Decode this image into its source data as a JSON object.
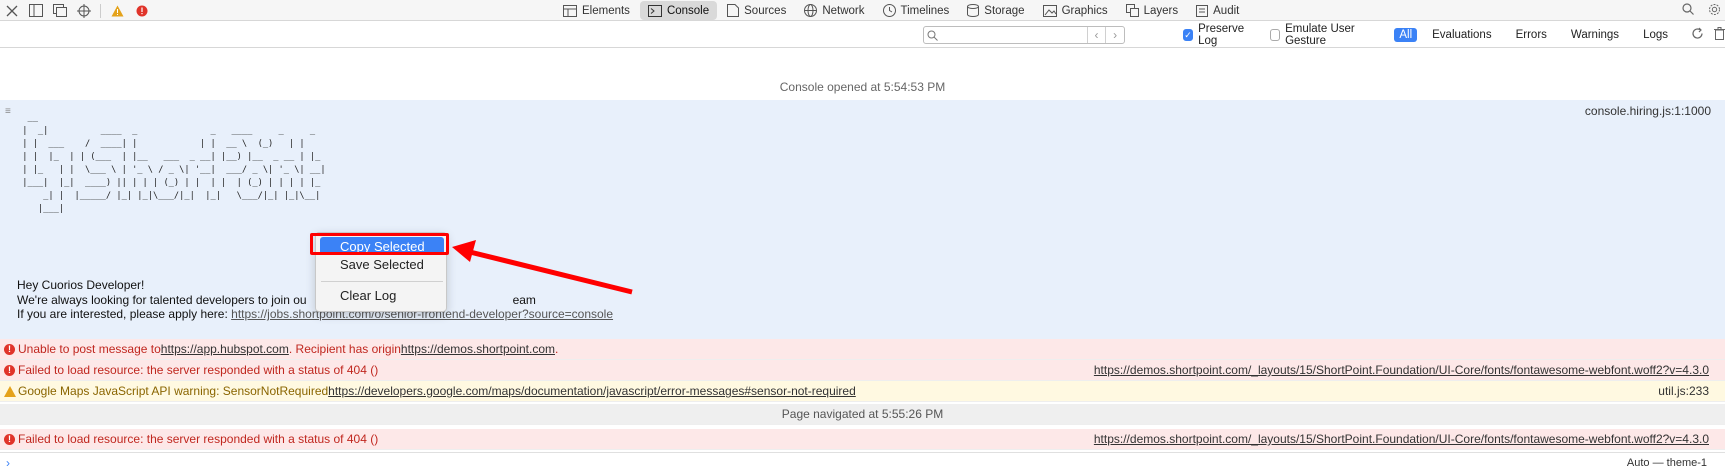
{
  "toolbar": {
    "tabs": [
      {
        "label": "Elements",
        "icon": "elements-icon"
      },
      {
        "label": "Console",
        "icon": "console-icon"
      },
      {
        "label": "Sources",
        "icon": "sources-icon"
      },
      {
        "label": "Network",
        "icon": "network-icon"
      },
      {
        "label": "Timelines",
        "icon": "timelines-icon"
      },
      {
        "label": "Storage",
        "icon": "storage-icon"
      },
      {
        "label": "Graphics",
        "icon": "graphics-icon"
      },
      {
        "label": "Layers",
        "icon": "layers-icon"
      },
      {
        "label": "Audit",
        "icon": "audit-icon"
      }
    ],
    "active_tab": "Console"
  },
  "filter": {
    "search_value": "",
    "preserve_log": "Preserve Log",
    "emulate_gesture": "Emulate User Gesture",
    "levels": [
      "All",
      "Evaluations",
      "Errors",
      "Warnings",
      "Logs"
    ]
  },
  "console": {
    "opened": "Console opened at 5:54:53 PM",
    "source": "console.hiring.js:1:1000",
    "greeting": "Hey Cuorios Developer!",
    "looking_a": "We're always looking for talented developers to join ou",
    "looking_b": "eam",
    "apply_prefix": "If you are interested, please apply here: ",
    "apply_link": "https://jobs.shortpoint.com/o/senior-frontend-developer?source=console",
    "rows": [
      {
        "type": "error",
        "text": "Unable to post message to ",
        "link1": "https://app.hubspot.com",
        "mid": ". Recipient has origin ",
        "link2": "https://demos.shortpoint.com",
        "end": ".",
        "src": ""
      },
      {
        "type": "error",
        "text": "Failed to load resource: the server responded with a status of 404 ()",
        "src": "https://demos.shortpoint.com/_layouts/15/ShortPoint.Foundation/UI-Core/fonts/fontawesome-webfont.woff2?v=4.3.0"
      },
      {
        "type": "warning",
        "text": "Google Maps JavaScript API warning: SensorNotRequired ",
        "link1": "https://developers.google.com/maps/documentation/javascript/error-messages#sensor-not-required",
        "src": "util.js:233"
      },
      {
        "type": "nav",
        "text": "Page navigated at 5:55:26 PM"
      },
      {
        "type": "error",
        "text": "Failed to load resource: the server responded with a status of 404 ()",
        "src": "https://demos.shortpoint.com/_layouts/15/ShortPoint.Foundation/UI-Core/fonts/fontawesome-webfont.woff2?v=4.3.0"
      }
    ],
    "context": "Auto — theme-1"
  },
  "context_menu": {
    "items": [
      "Copy Selected",
      "Save Selected",
      "Clear Log"
    ]
  }
}
